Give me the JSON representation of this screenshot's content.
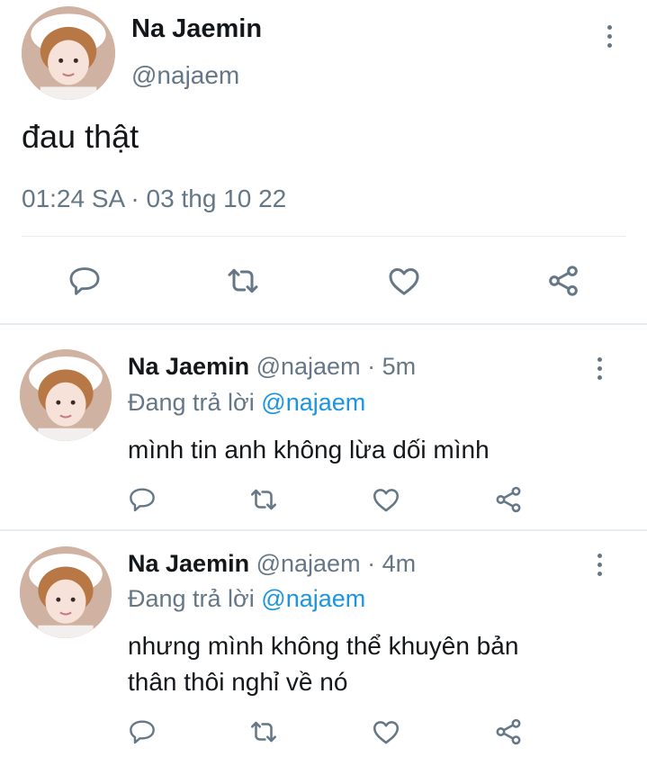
{
  "main_tweet": {
    "author_name": "Na Jaemin",
    "author_handle": "@najaem",
    "text": "đau thật",
    "timestamp": "01:24 SA · 03 thg 10 22"
  },
  "replies": [
    {
      "author_name": "Na Jaemin",
      "author_handle": "@najaem",
      "age": "· 5m",
      "replying_prefix": "Đang trả lời",
      "replying_to": "@najaem",
      "text_lines": [
        "mình tin anh không lừa dối mình"
      ]
    },
    {
      "author_name": "Na Jaemin",
      "author_handle": "@najaem",
      "age": "· 4m",
      "replying_prefix": "Đang trả lời",
      "replying_to": "@najaem",
      "text_lines": [
        "nhưng mình không thể khuyên bản",
        "thân thôi nghỉ về nó"
      ]
    }
  ],
  "icons": {
    "reply": "reply-icon",
    "retweet": "retweet-icon",
    "like": "like-icon",
    "share": "share-icon",
    "more": "more-options-icon"
  },
  "colors": {
    "icon_gray": "#657786",
    "link_blue": "#1b95e0",
    "divider": "#e6ecf0"
  }
}
